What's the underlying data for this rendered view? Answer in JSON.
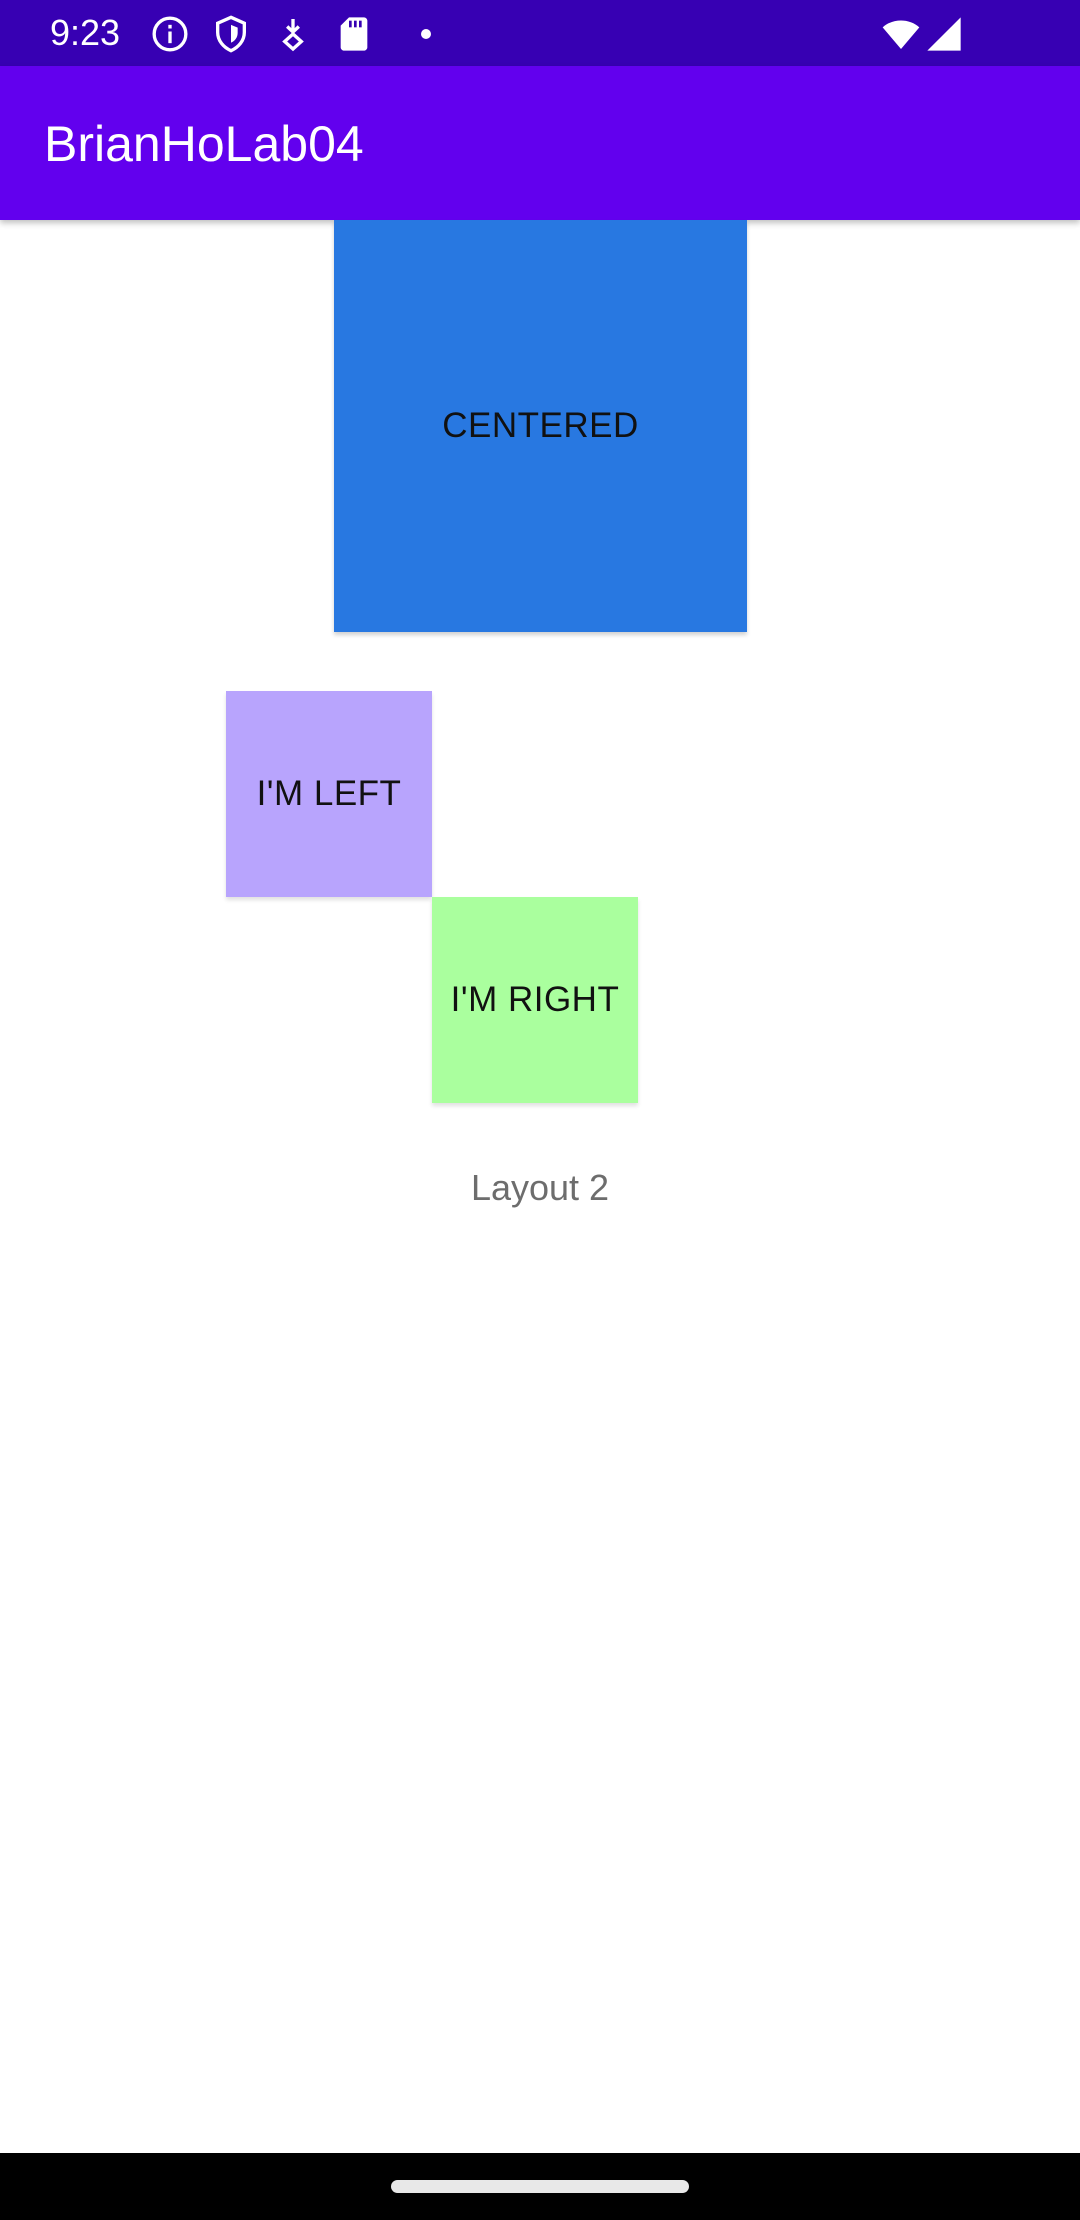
{
  "status_bar": {
    "time": "9:23",
    "background": "#3700b3",
    "icons": [
      "info-icon",
      "shield-icon",
      "download-icon",
      "sd-card-icon",
      "notification-dot-icon",
      "wifi-icon",
      "cell-signal-icon"
    ]
  },
  "app_bar": {
    "title": "BrianHoLab04",
    "background": "#6200ee"
  },
  "boxes": {
    "centered": {
      "label": "CENTERED",
      "color": "#2878e1"
    },
    "left": {
      "label": "I'M LEFT",
      "color": "#b8a4fd"
    },
    "right": {
      "label": "I'M RIGHT",
      "color": "#aaff9e"
    }
  },
  "layout_label": "Layout 2"
}
